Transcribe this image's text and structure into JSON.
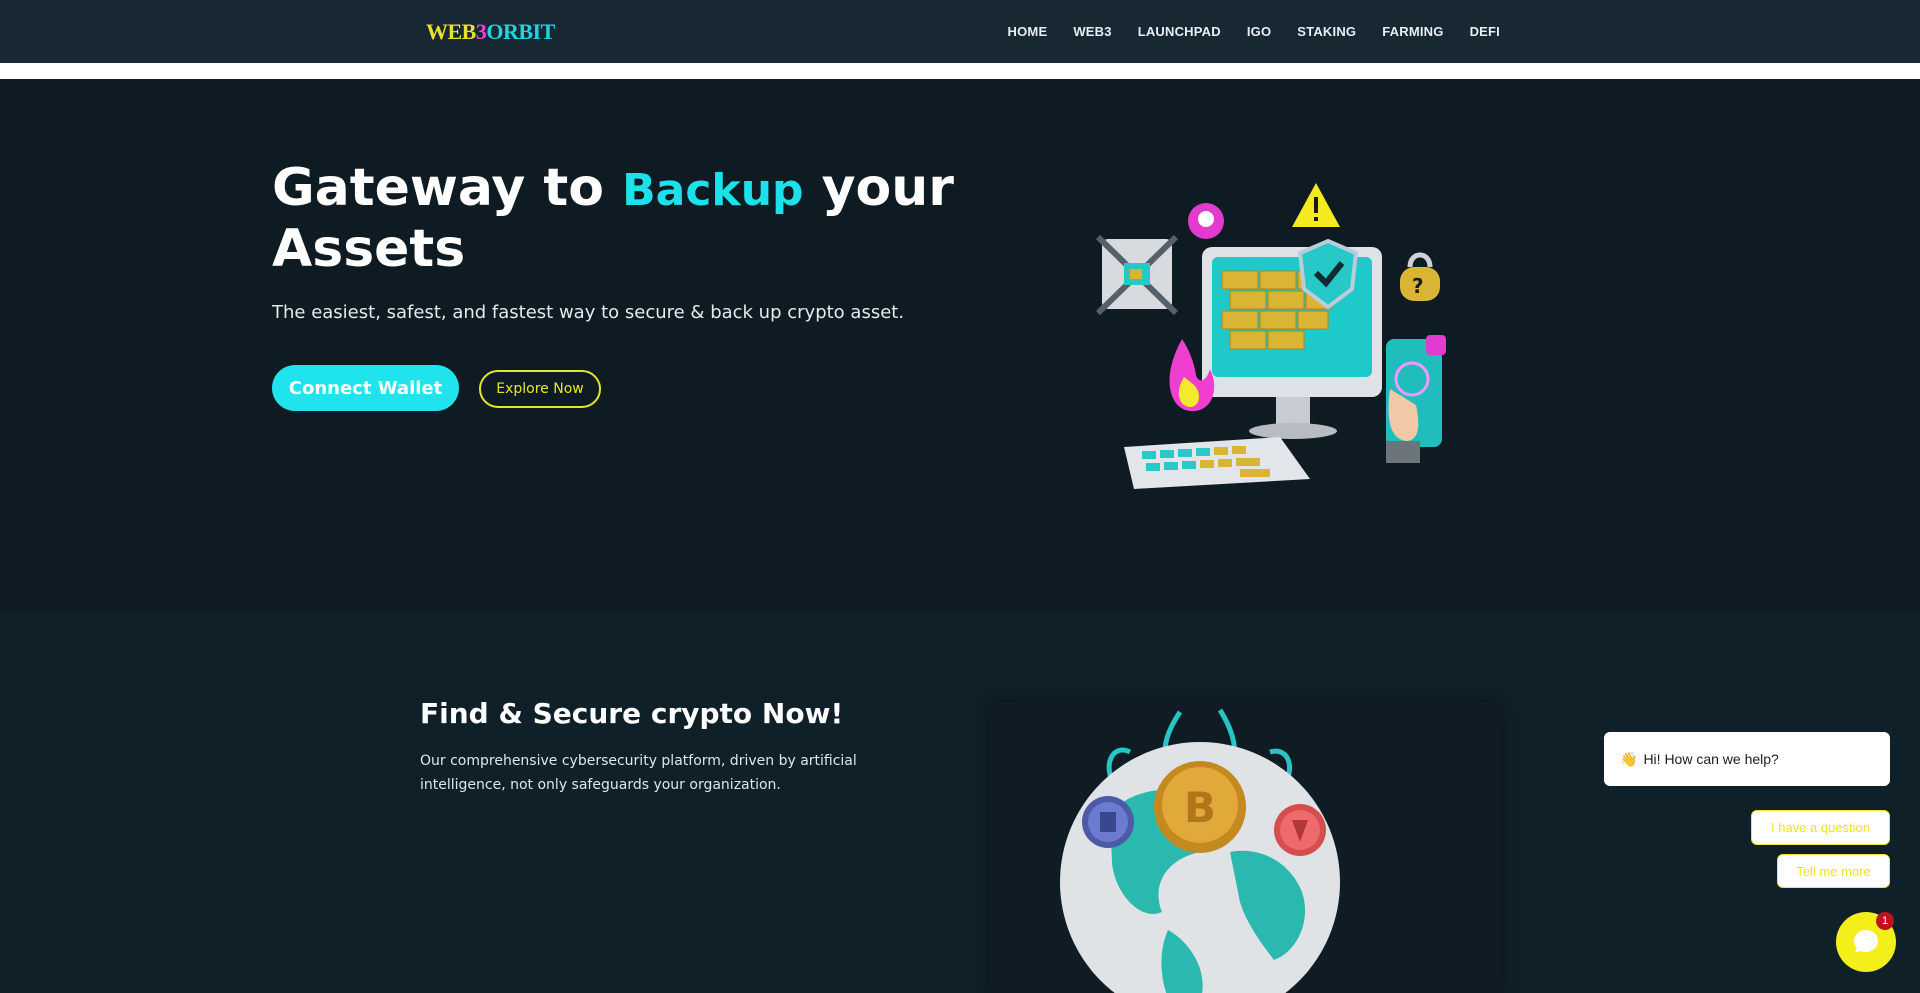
{
  "header": {
    "logo": {
      "part1": "WEB",
      "part2": "3",
      "part3": "ORBIT"
    },
    "nav": [
      "HOME",
      "WEB3",
      "LAUNCHPAD",
      "IGO",
      "STAKING",
      "FARMING",
      "DEFI"
    ]
  },
  "hero": {
    "title_part1": "Gateway to ",
    "title_accent": "Backup",
    "title_part2": " your Assets",
    "subtitle": "The easiest, safest, and fastest way to secure & back up crypto asset.",
    "connect_label": "Connect Wallet",
    "explore_label": "Explore Now"
  },
  "section2": {
    "title": "Find & Secure crypto Now!",
    "body": "Our comprehensive cybersecurity platform, driven by artificial intelligence, not only safeguards your organization."
  },
  "chat": {
    "greeting_emoji": "👋",
    "greeting": "Hi! How can we help?",
    "options": [
      "I have a question",
      "Tell me more"
    ],
    "badge_count": "1"
  },
  "colors": {
    "accent_cyan": "#1ce1ea",
    "accent_yellow": "#e7e52b",
    "background": "#0f1b22",
    "header": "#172833"
  }
}
